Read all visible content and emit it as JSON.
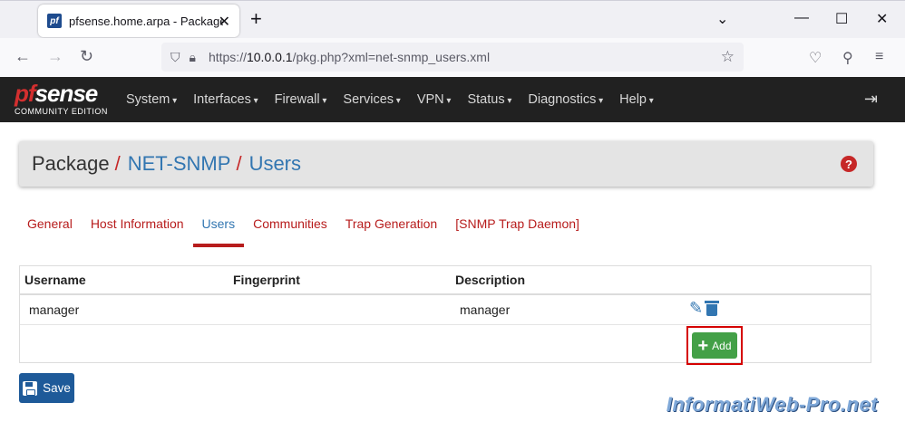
{
  "browser": {
    "tab_title": "pfsense.home.arpa - Package: N",
    "favicon": "pf",
    "url_prefix": "https://",
    "url_host": "10.0.0.1",
    "url_path": "/pkg.php?xml=net-snmp_users.xml"
  },
  "header": {
    "logo_main_pf": "pf",
    "logo_main_rest": "sense",
    "logo_sub": "COMMUNITY EDITION",
    "menu": [
      "System",
      "Interfaces",
      "Firewall",
      "Services",
      "VPN",
      "Status",
      "Diagnostics",
      "Help"
    ]
  },
  "breadcrumb": {
    "root": "Package",
    "sep": "/",
    "item1": "NET-SNMP",
    "item2": "Users"
  },
  "tabs": [
    "General",
    "Host Information",
    "Users",
    "Communities",
    "Trap Generation",
    "[SNMP Trap Daemon]"
  ],
  "active_tab": "Users",
  "table": {
    "headers": {
      "username": "Username",
      "fingerprint": "Fingerprint",
      "description": "Description"
    },
    "rows": [
      {
        "username": "manager",
        "fingerprint": "",
        "description": "manager"
      }
    ],
    "add_label": "Add"
  },
  "save_label": "Save",
  "watermark": "InformatiWeb-Pro.net",
  "colors": {
    "accent_red": "#b71c1c",
    "link_blue": "#3276b1",
    "add_green": "#43a047",
    "save_blue": "#1e5a99"
  }
}
